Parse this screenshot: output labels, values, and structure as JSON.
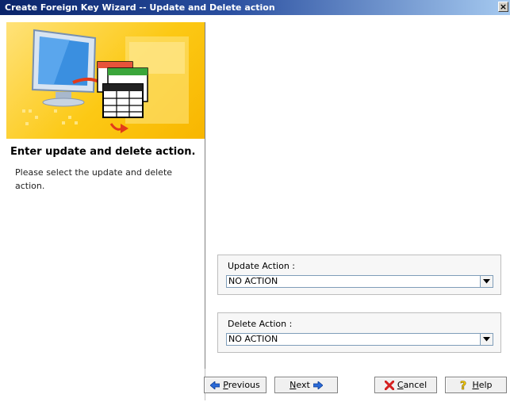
{
  "window": {
    "title": "Create Foreign Key Wizard -- Update and Delete action",
    "close_glyph": "×"
  },
  "step": {
    "title": "Enter update and delete action.",
    "description": "Please select the update and delete action."
  },
  "update_action": {
    "label": "Update Action :",
    "value": "NO ACTION"
  },
  "delete_action": {
    "label": "Delete Action :",
    "value": "NO ACTION"
  },
  "buttons": {
    "previous": "Previous",
    "next": "Next",
    "cancel": "Cancel",
    "help": "Help"
  },
  "colors": {
    "titlebar": "#0a246a",
    "banner": "#fcc915",
    "accent_arrow": "#2a6ad8",
    "cancel_icon": "#d42020",
    "help_icon": "#f0c800"
  },
  "icons": [
    "close-icon",
    "computer-monitor-icon",
    "table-icon",
    "previous-arrow-icon",
    "next-arrow-icon",
    "cancel-x-icon",
    "help-question-icon",
    "dropdown-arrow-icon"
  ]
}
